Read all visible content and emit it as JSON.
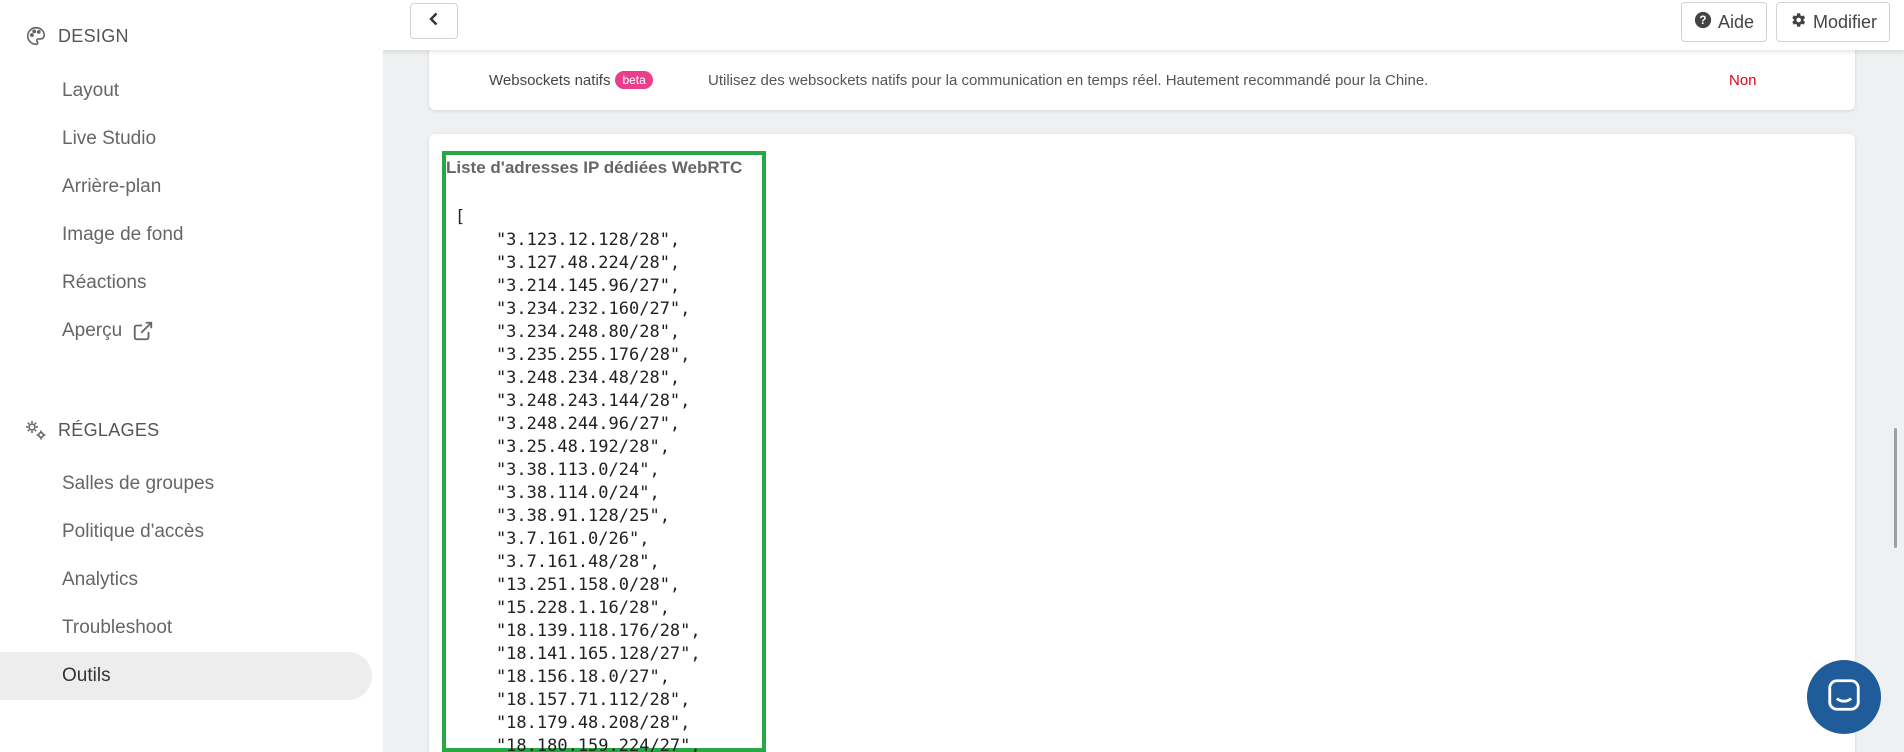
{
  "sidebar": {
    "design": {
      "label": "DESIGN",
      "icon": "palette-icon",
      "items": [
        {
          "label": "Layout"
        },
        {
          "label": "Live Studio"
        },
        {
          "label": "Arrière-plan"
        },
        {
          "label": "Image de fond"
        },
        {
          "label": "Réactions"
        },
        {
          "label": "Aperçu",
          "icon": "external-link-icon"
        }
      ]
    },
    "settings": {
      "label": "RÉGLAGES",
      "icon": "gears-icon",
      "items": [
        {
          "label": "Salles de groupes"
        },
        {
          "label": "Politique d'accès"
        },
        {
          "label": "Analytics"
        },
        {
          "label": "Troubleshoot"
        },
        {
          "label": "Outils",
          "active": true
        }
      ]
    }
  },
  "topbar": {
    "back_icon": "chevron-left-icon",
    "help_label": "Aide",
    "help_icon": "question-circle-icon",
    "edit_label": "Modifier",
    "edit_icon": "gear-icon"
  },
  "websockets": {
    "label": "Websockets natifs",
    "badge": "beta",
    "description": "Utilisez des websockets natifs pour la communication en temps réel. Hautement recommandé pour la Chine.",
    "value": "Non"
  },
  "ip_list": {
    "title": "Liste d'adresses IP dédiées WebRTC",
    "code": "[\n    \"3.123.12.128/28\",\n    \"3.127.48.224/28\",\n    \"3.214.145.96/27\",\n    \"3.234.232.160/27\",\n    \"3.234.248.80/28\",\n    \"3.235.255.176/28\",\n    \"3.248.234.48/28\",\n    \"3.248.243.144/28\",\n    \"3.248.244.96/27\",\n    \"3.25.48.192/28\",\n    \"3.38.113.0/24\",\n    \"3.38.114.0/24\",\n    \"3.38.91.128/25\",\n    \"3.7.161.0/26\",\n    \"3.7.161.48/28\",\n    \"13.251.158.0/28\",\n    \"15.228.1.16/28\",\n    \"18.139.118.176/28\",\n    \"18.141.165.128/27\",\n    \"18.156.18.0/27\",\n    \"18.157.71.112/28\",\n    \"18.179.48.208/28\",\n    \"18.180.159.224/27\","
  },
  "chat": {
    "icon": "chat-icon"
  },
  "colors": {
    "highlight": "#28a745",
    "badge": "#e83e8c",
    "value_no": "#e0001b",
    "chat": "#1f5c99"
  }
}
